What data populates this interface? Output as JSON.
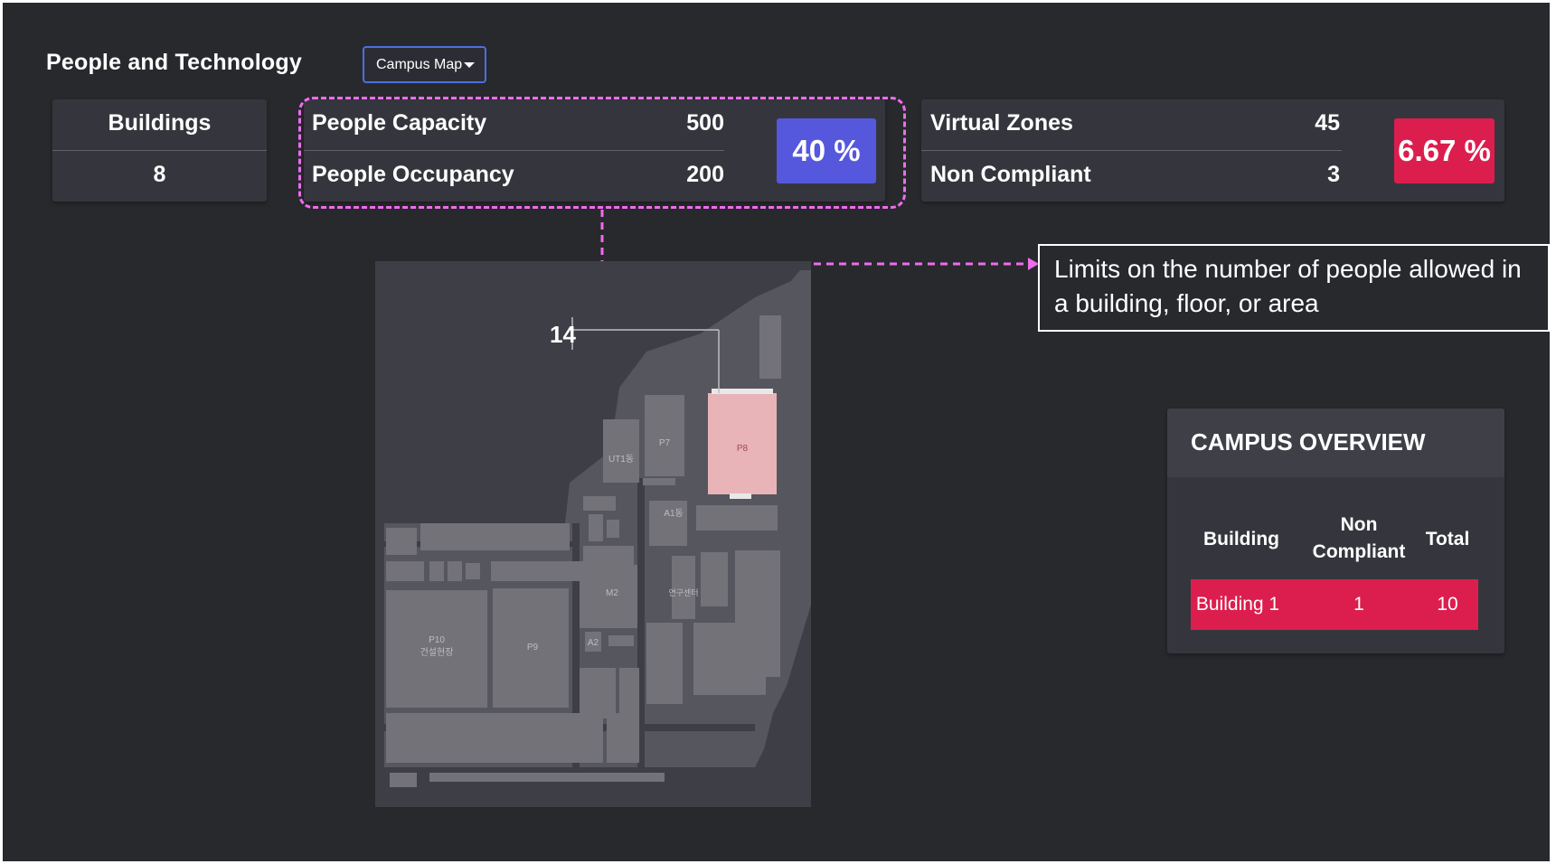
{
  "header": {
    "title": "People and Technology",
    "view_dropdown": "Campus Map"
  },
  "buildings_card": {
    "label": "Buildings",
    "value": "8"
  },
  "people_card": {
    "capacity_label": "People Capacity",
    "capacity_value": "500",
    "occupancy_label": "People Occupancy",
    "occupancy_value": "200",
    "percent": "40 %"
  },
  "zones_card": {
    "zones_label": "Virtual Zones",
    "zones_value": "45",
    "noncompliant_label": "Non Compliant",
    "noncompliant_value": "3",
    "percent": "6.67 %"
  },
  "callout": {
    "text": "Limits on the number of people allowed in a building, floor, or area"
  },
  "map": {
    "marker_label": "14",
    "buildings": {
      "p7": "P7",
      "p8": "P8",
      "ut": "UT1동",
      "a1": "A1동",
      "m2": "M2",
      "research": "연구센터",
      "a2": "A2",
      "p9": "P9",
      "p10": "P10",
      "p10_sub": "건설현장"
    }
  },
  "campus_overview": {
    "title": "CAMPUS OVERVIEW",
    "headers": {
      "building": "Building",
      "noncompliant_1": "Non",
      "noncompliant_2": "Compliant",
      "total": "Total"
    },
    "rows": [
      {
        "building": "Building 1",
        "noncompliant": "1",
        "total": "10"
      }
    ]
  },
  "colors": {
    "background": "#28292d",
    "card": "#35363d",
    "accent_blue": "#5558dd",
    "accent_red": "#dc1e4e",
    "highlight_dashed": "#ee6cee",
    "map_highlight": "#e8b4b8"
  }
}
